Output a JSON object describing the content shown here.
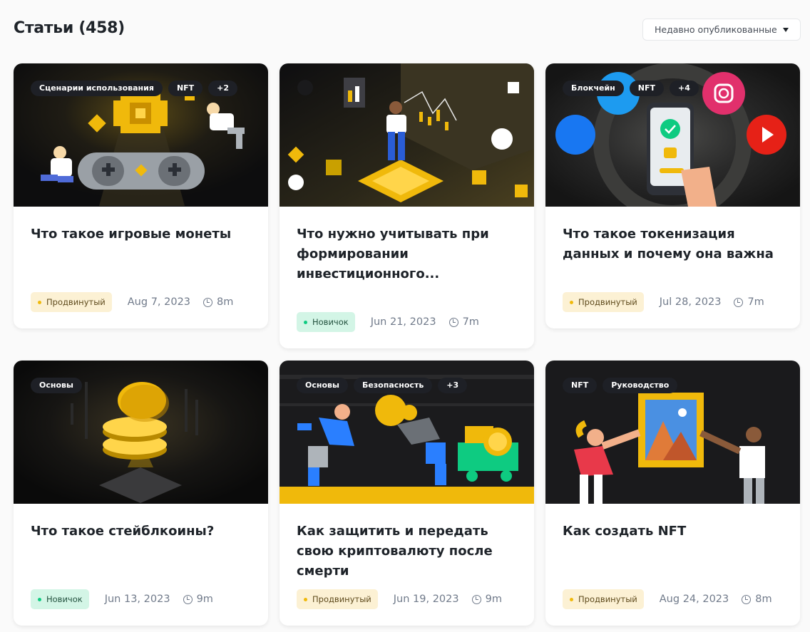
{
  "header": {
    "title": "Статьи (458)",
    "sort": {
      "selected": "Недавно опубликованные"
    }
  },
  "articles": [
    {
      "title": "Что такое игровые монеты",
      "tags": [
        "Сценарии использования",
        "NFT",
        "+2"
      ],
      "level": "Продвинутый",
      "date": "Aug 7, 2023",
      "read_time": "8m",
      "image_icons": [
        "gamepad-icon",
        "coin-icon",
        "astronaut-icon"
      ]
    },
    {
      "title": "Что нужно учитывать при формировании инвестиционного...",
      "tags": [],
      "level": "Новичок",
      "date": "Jun 21, 2023",
      "read_time": "7m",
      "image_icons": [
        "investor-icon",
        "chart-icon"
      ]
    },
    {
      "title": "Что такое токенизация данных и почему она важна",
      "tags": [
        "Блокчейн",
        "NFT",
        "+4"
      ],
      "level": "Продвинутый",
      "date": "Jul 28, 2023",
      "read_time": "7m",
      "image_icons": [
        "phone-lock-icon",
        "facebook-icon",
        "twitter-icon",
        "instagram-icon",
        "youtube-icon"
      ]
    },
    {
      "title": "Что такое стейблкоины?",
      "tags": [
        "Основы"
      ],
      "level": "Новичок",
      "date": "Jun 13, 2023",
      "read_time": "9m",
      "image_icons": [
        "coin-stack-icon"
      ]
    },
    {
      "title": "Как защитить и передать свою криптовалюту после смерти",
      "tags": [
        "Основы",
        "Безопасность",
        "+3"
      ],
      "level": "Продвинутый",
      "date": "Jun 19, 2023",
      "read_time": "9m",
      "image_icons": [
        "people-coin-icon",
        "cart-icon"
      ]
    },
    {
      "title": "Как создать NFT",
      "tags": [
        "NFT",
        "Руководство"
      ],
      "level": "Продвинутый",
      "date": "Aug 24, 2023",
      "read_time": "8m",
      "image_icons": [
        "painting-icon",
        "artist-icon"
      ]
    }
  ],
  "colors": {
    "accent": "#f0b90b",
    "beginner": "#0ecb81",
    "text": "#1e2329",
    "muted": "#707a8a"
  }
}
